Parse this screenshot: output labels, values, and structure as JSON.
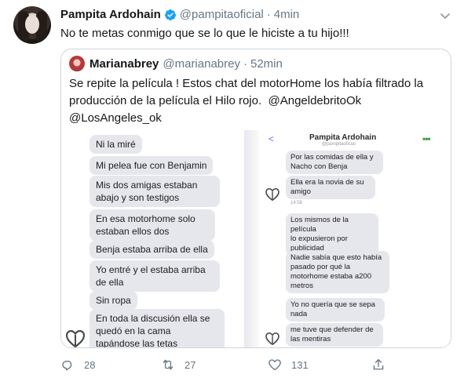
{
  "tweet": {
    "author_name": "Pampita Ardohain",
    "author_handle": "@pampitaoficial",
    "separator": "·",
    "time": "4min",
    "text": "No te metas conmigo que se lo que le hiciste a tu hijo!!!",
    "verified_icon": "verified-badge-icon",
    "caret_icon": "chevron-down-icon"
  },
  "quote": {
    "author_name": "Marianabrey",
    "author_handle": "@marianabrey",
    "separator": "·",
    "time": "52min",
    "text_line1": "Se repite la película ! Estos chat del motorHome los había filtrado la",
    "text_line2": "producción de la película el Hilo rojo.",
    "mention1": "@AngeldebritoOk",
    "mention2": "@LosAngeles_ok"
  },
  "chat_left": {
    "messages": [
      "Ni la miré",
      "Mi pelea fue con Benjamin",
      "Mis dos amigas estaban",
      "abajo y son testigos",
      "En esa motorhome solo",
      "estaban ellos dos",
      "Benja estaba arriba de ella",
      "Yo entré y el estaba arriba",
      "de ella",
      "Sin ropa",
      "En toda la discusión ella se",
      "quedó en la cama",
      "tapándose las tetas"
    ]
  },
  "chat_right": {
    "header_title": "Pampita Ardohain",
    "header_sub": "@pampitaoficial",
    "back_glyph": "<",
    "menu_glyph": "•••",
    "time_label": "14:58",
    "messages": [
      "Por las comidas de ella y",
      "Nacho con Benja",
      "Ella era la novia de su",
      "amigo",
      "Los mismos de la película",
      "lo expusieron por",
      "publicidad",
      "Nadie sabía que esto había",
      "pasado por qué la",
      "motorhome estaba a200",
      "metros",
      "Yo no quería que se sepa",
      "nada",
      "me tuve que defender de",
      "las mentiras"
    ]
  },
  "actions": {
    "reply_count": "28",
    "retweet_count": "27",
    "like_count": "131",
    "reply_icon": "reply-icon",
    "retweet_icon": "retweet-icon",
    "like_icon": "heart-icon",
    "share_icon": "share-icon"
  }
}
